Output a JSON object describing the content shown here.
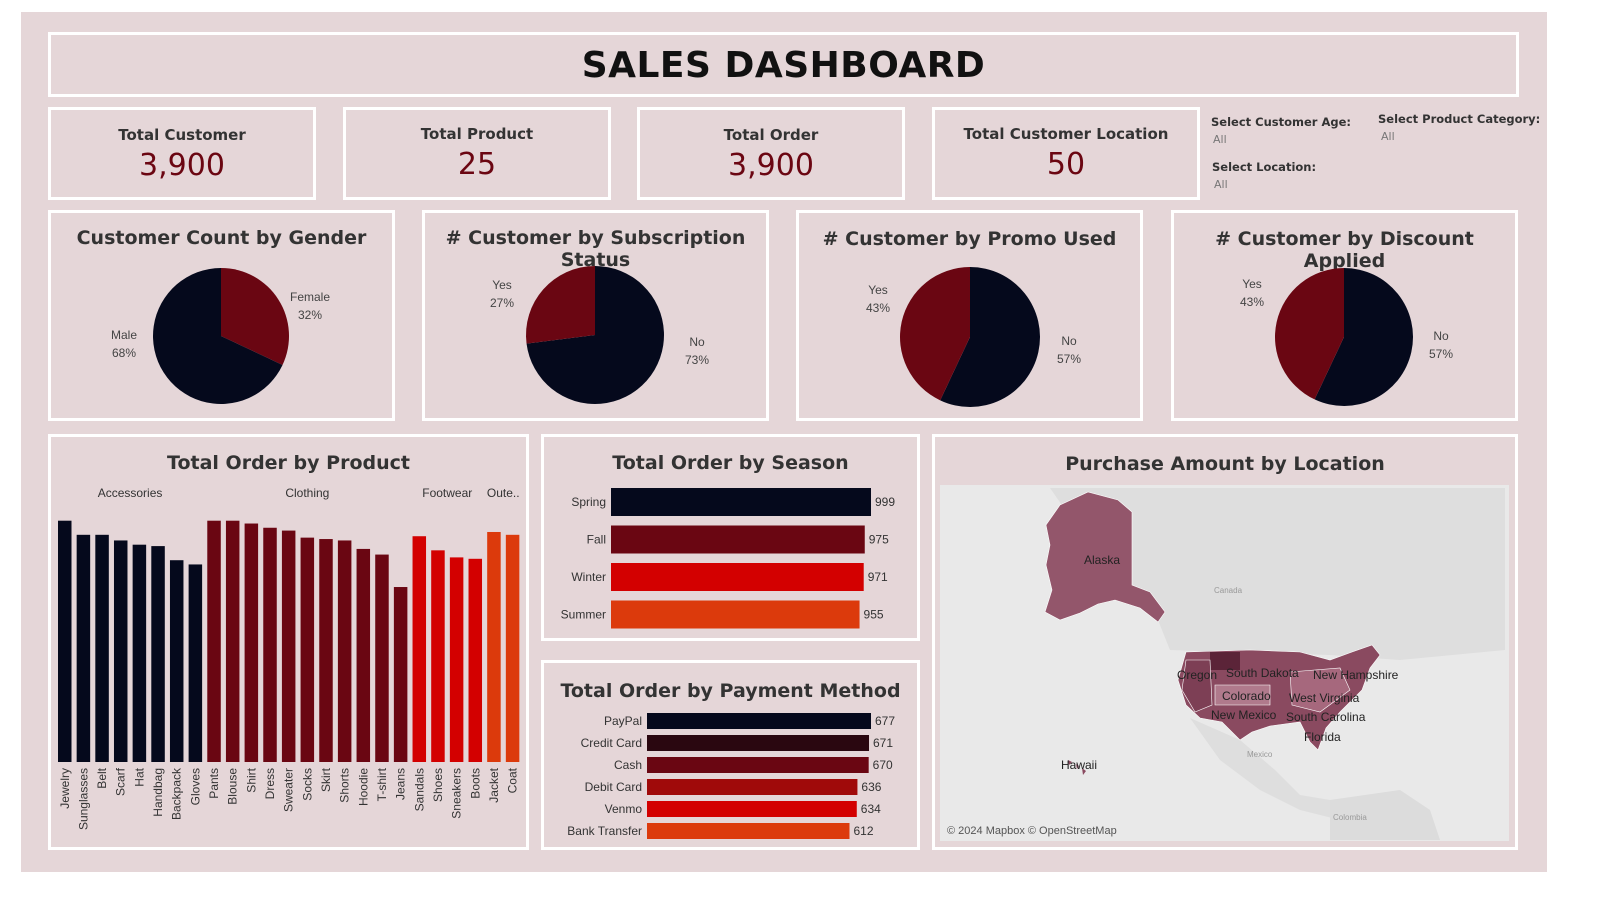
{
  "header": {
    "title": "SALES DASHBOARD"
  },
  "kpis": [
    {
      "label": "Total Customer",
      "value": "3,900"
    },
    {
      "label": "Total Product",
      "value": "25"
    },
    {
      "label": "Total Order",
      "value": "3,900"
    },
    {
      "label": "Total Customer Location",
      "value": "50"
    }
  ],
  "filters": {
    "age": {
      "label": "Select Customer Age:",
      "value": "All"
    },
    "category": {
      "label": "Select Product Category:",
      "value": "All"
    },
    "location": {
      "label": "Select Location:",
      "value": "All"
    }
  },
  "colors": {
    "dark": "#05091c",
    "maroon": "#6a0612",
    "red": "#d30000",
    "orange": "#dc3a0c",
    "accent": "#6b0612",
    "background": "#e5d6d8"
  },
  "chart_data": [
    {
      "type": "pie",
      "title": "Customer Count by Gender",
      "slices": [
        {
          "label": "Female",
          "pct": "32%",
          "value": 32,
          "color": "#6a0612"
        },
        {
          "label": "Male",
          "pct": "68%",
          "value": 68,
          "color": "#05091c"
        }
      ]
    },
    {
      "type": "pie",
      "title": "# Customer by Subscription Status",
      "slices": [
        {
          "label": "No",
          "pct": "73%",
          "value": 73,
          "color": "#05091c"
        },
        {
          "label": "Yes",
          "pct": "27%",
          "value": 27,
          "color": "#6a0612"
        }
      ]
    },
    {
      "type": "pie",
      "title": "# Customer by Promo Used",
      "slices": [
        {
          "label": "No",
          "pct": "57%",
          "value": 57,
          "color": "#05091c"
        },
        {
          "label": "Yes",
          "pct": "43%",
          "value": 43,
          "color": "#6a0612"
        }
      ]
    },
    {
      "type": "pie",
      "title": "# Customer by Discount Applied",
      "slices": [
        {
          "label": "No",
          "pct": "57%",
          "value": 57,
          "color": "#05091c"
        },
        {
          "label": "Yes",
          "pct": "43%",
          "value": 43,
          "color": "#6a0612"
        }
      ]
    },
    {
      "type": "bar",
      "title": "Total Order by Product",
      "groups": [
        {
          "name": "Accessories",
          "color": "#05091c",
          "categories": [
            "Jewelry",
            "Sunglasses",
            "Belt",
            "Scarf",
            "Hat",
            "Handbag",
            "Backpack",
            "Gloves"
          ],
          "values": [
            171,
            161,
            161,
            157,
            154,
            153,
            143,
            140
          ]
        },
        {
          "name": "Clothing",
          "color": "#6a0612",
          "categories": [
            "Pants",
            "Blouse",
            "Shirt",
            "Dress",
            "Sweater",
            "Socks",
            "Skirt",
            "Shorts",
            "Hoodie",
            "T-shirt",
            "Jeans"
          ],
          "values": [
            171,
            171,
            169,
            166,
            164,
            159,
            158,
            157,
            151,
            147,
            124
          ]
        },
        {
          "name": "Footwear",
          "color": "#d30000",
          "categories": [
            "Sandals",
            "Shoes",
            "Sneakers",
            "Boots"
          ],
          "values": [
            160,
            150,
            145,
            144
          ]
        },
        {
          "name": "Oute..",
          "color": "#dc3a0c",
          "categories": [
            "Jacket",
            "Coat"
          ],
          "values": [
            163,
            161
          ]
        }
      ],
      "ylim": [
        0,
        180
      ]
    },
    {
      "type": "bar",
      "orientation": "horizontal",
      "title": "Total Order by Season",
      "categories": [
        "Spring",
        "Fall",
        "Winter",
        "Summer"
      ],
      "values": [
        999,
        975,
        971,
        955
      ],
      "colors": [
        "#05091c",
        "#6a0612",
        "#d30000",
        "#dc3a0c"
      ]
    },
    {
      "type": "bar",
      "orientation": "horizontal",
      "title": "Total Order by Payment Method",
      "categories": [
        "PayPal",
        "Credit Card",
        "Cash",
        "Debit Card",
        "Venmo",
        "Bank Transfer"
      ],
      "values": [
        677,
        671,
        670,
        636,
        634,
        612
      ],
      "colors": [
        "#05091c",
        "#2a0710",
        "#6a0612",
        "#a00a0a",
        "#d30000",
        "#dc3a0c"
      ]
    }
  ],
  "map": {
    "title": "Purchase Amount by Location",
    "state_labels": [
      "Alaska",
      "Oregon",
      "South Dakota",
      "New Hampshire",
      "Colorado",
      "West Virginia",
      "New Mexico",
      "South Carolina",
      "Florida",
      "Hawaii"
    ],
    "context_labels": [
      "Canada",
      "Mexico",
      "Colombia"
    ],
    "attribution": "© 2024 Mapbox © OpenStreetMap"
  }
}
